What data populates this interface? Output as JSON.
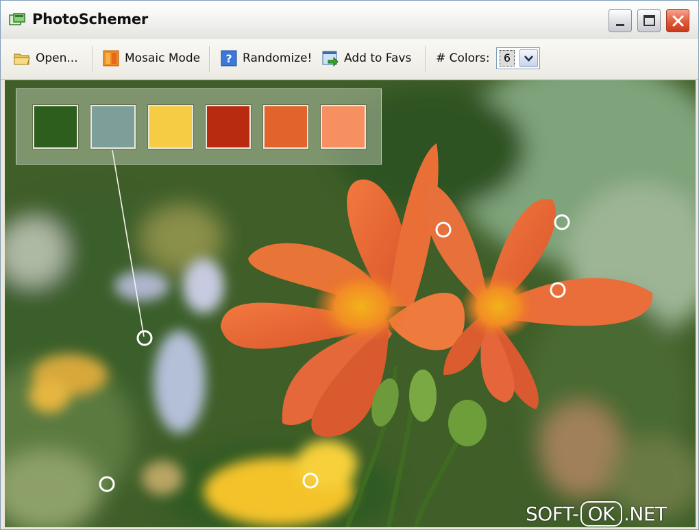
{
  "window": {
    "title": "PhotoSchemer"
  },
  "toolbar": {
    "open_label": "Open...",
    "mosaic_label": "Mosaic Mode",
    "randomize_label": "Randomize!",
    "favs_label": "Add to Favs",
    "colors_label": "# Colors:",
    "colors_value": "6"
  },
  "icons": {
    "app": "app-window-icon",
    "open": "folder-icon",
    "mosaic": "mosaic-icon",
    "randomize": "question-icon",
    "favs": "add-to-favorites-icon",
    "minimize": "minimize-icon",
    "maximize": "maximize-icon",
    "close": "close-icon",
    "dropdown": "chevron-down-icon"
  },
  "palette": {
    "swatches": [
      "#2e5e1e",
      "#7e9e9a",
      "#f5cc44",
      "#b92b10",
      "#e2632b",
      "#f79060"
    ]
  },
  "watermark": {
    "left": "SOFT-",
    "middle": "OK",
    "right": ".NET"
  }
}
